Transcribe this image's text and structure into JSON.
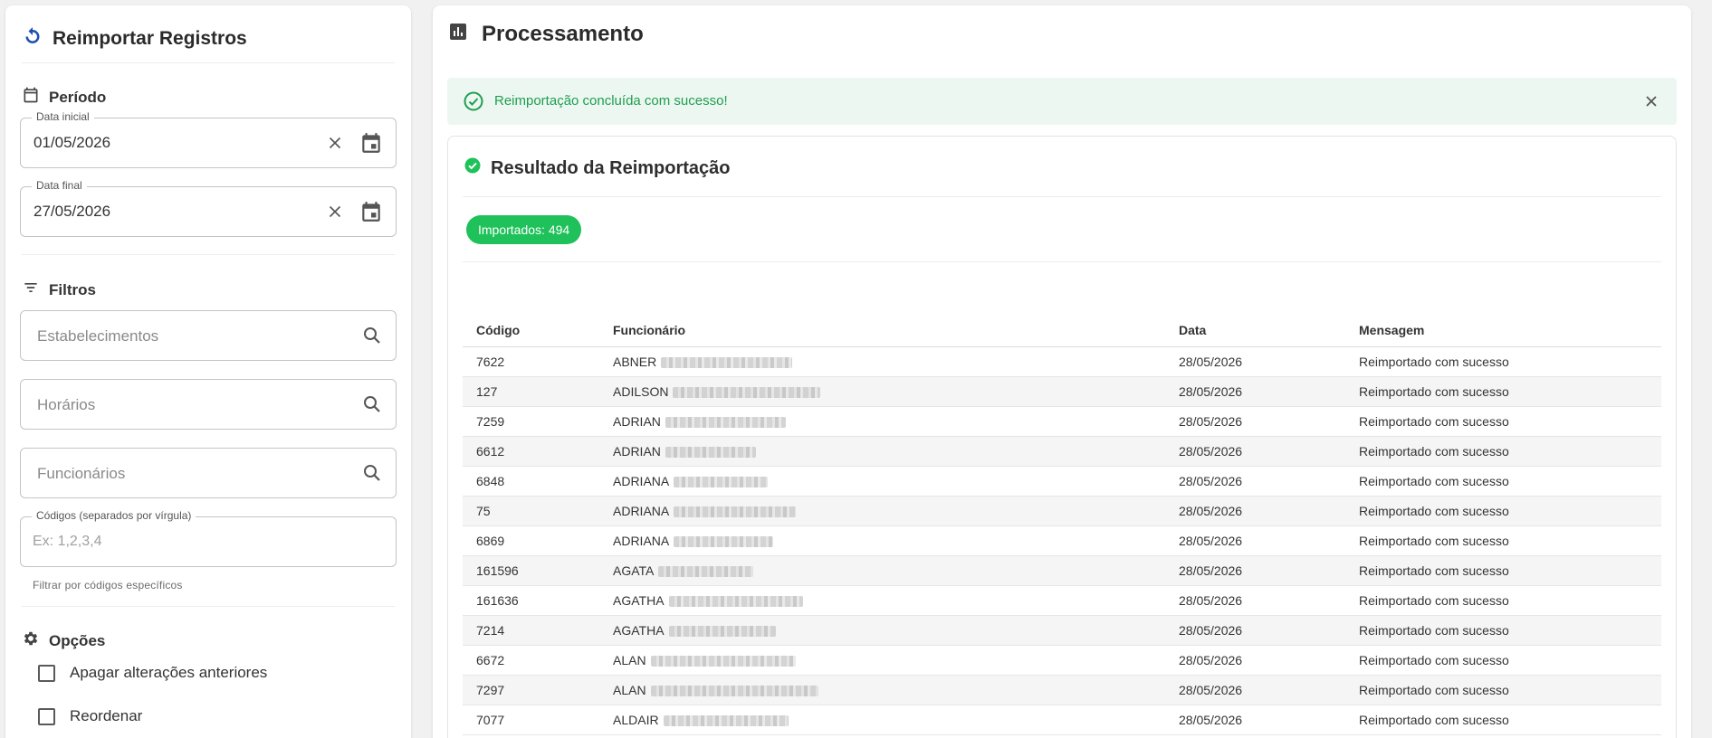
{
  "left": {
    "title": "Reimportar Registros",
    "periodo": {
      "heading": "Período",
      "start": {
        "label": "Data inicial",
        "value": "01/05/2026"
      },
      "end": {
        "label": "Data final",
        "value": "27/05/2026"
      }
    },
    "filtros": {
      "heading": "Filtros",
      "estabelecimentos_placeholder": "Estabelecimentos",
      "horarios_placeholder": "Horários",
      "funcionarios_placeholder": "Funcionários",
      "codigos": {
        "label": "Códigos (separados por vírgula)",
        "placeholder": "Ex: 1,2,3,4",
        "helper": "Filtrar por códigos específicos"
      }
    },
    "opcoes": {
      "heading": "Opções",
      "apagar_label": "Apagar alterações anteriores",
      "reordenar_label": "Reordenar"
    }
  },
  "right": {
    "title": "Processamento",
    "alert_text": "Reimportação concluída com sucesso!",
    "result_title": "Resultado da Reimportação",
    "badge": "Importados: 494",
    "table": {
      "headers": [
        "Código",
        "Funcionário",
        "Data",
        "Mensagem"
      ],
      "rows": [
        {
          "codigo": "7622",
          "funcionario": "ABNER",
          "data": "28/05/2026",
          "mensagem": "Reimportado com sucesso"
        },
        {
          "codigo": "127",
          "funcionario": "ADILSON",
          "data": "28/05/2026",
          "mensagem": "Reimportado com sucesso"
        },
        {
          "codigo": "7259",
          "funcionario": "ADRIAN",
          "data": "28/05/2026",
          "mensagem": "Reimportado com sucesso"
        },
        {
          "codigo": "6612",
          "funcionario": "ADRIAN",
          "data": "28/05/2026",
          "mensagem": "Reimportado com sucesso"
        },
        {
          "codigo": "6848",
          "funcionario": "ADRIANA",
          "data": "28/05/2026",
          "mensagem": "Reimportado com sucesso"
        },
        {
          "codigo": "75",
          "funcionario": "ADRIANA",
          "data": "28/05/2026",
          "mensagem": "Reimportado com sucesso"
        },
        {
          "codigo": "6869",
          "funcionario": "ADRIANA",
          "data": "28/05/2026",
          "mensagem": "Reimportado com sucesso"
        },
        {
          "codigo": "161596",
          "funcionario": "AGATA",
          "data": "28/05/2026",
          "mensagem": "Reimportado com sucesso"
        },
        {
          "codigo": "161636",
          "funcionario": "AGATHA",
          "data": "28/05/2026",
          "mensagem": "Reimportado com sucesso"
        },
        {
          "codigo": "7214",
          "funcionario": "AGATHA",
          "data": "28/05/2026",
          "mensagem": "Reimportado com sucesso"
        },
        {
          "codigo": "6672",
          "funcionario": "ALAN",
          "data": "28/05/2026",
          "mensagem": "Reimportado com sucesso"
        },
        {
          "codigo": "7297",
          "funcionario": "ALAN",
          "data": "28/05/2026",
          "mensagem": "Reimportado com sucesso"
        },
        {
          "codigo": "7077",
          "funcionario": "ALDAIR",
          "data": "28/05/2026",
          "mensagem": "Reimportado com sucesso"
        }
      ]
    }
  },
  "colors": {
    "accent_blue": "#1f4fb0",
    "success_green": "#1fc15a",
    "alert_bg": "#edf7f2",
    "alert_text": "#1e9e4f"
  }
}
